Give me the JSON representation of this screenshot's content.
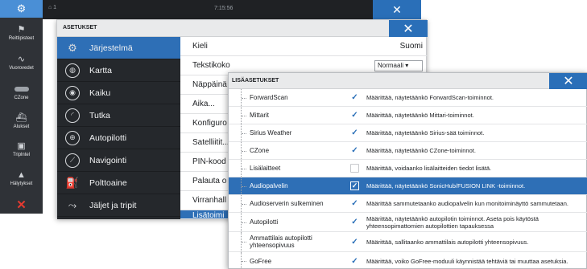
{
  "topbar": {
    "time": "7:15:56",
    "left_indicator": "⌂ 1",
    "close_glyph": "✕"
  },
  "rail": {
    "items": [
      {
        "label": "Reittipisteet",
        "icon": "flag-icon"
      },
      {
        "label": "Vuorovedet",
        "icon": "tide-icon"
      },
      {
        "label": "CZone",
        "icon": "czone-icon"
      },
      {
        "label": "Alukset",
        "icon": "ship-icon"
      },
      {
        "label": "Triplntel",
        "icon": "tripintel-icon"
      },
      {
        "label": "Hälytykset",
        "icon": "alarm-icon"
      }
    ],
    "close_glyph": "✕"
  },
  "settings": {
    "title": "ASETUKSET",
    "close_glyph": "✕",
    "categories": [
      {
        "label": "Järjestelmä",
        "icon": "gear-icon",
        "glyph": "⚙"
      },
      {
        "label": "Kartta",
        "icon": "globe-icon",
        "glyph": "◍"
      },
      {
        "label": "Kaiku",
        "icon": "echo-icon",
        "glyph": "◉"
      },
      {
        "label": "Tutka",
        "icon": "radar-icon",
        "glyph": "◜"
      },
      {
        "label": "Autopilotti",
        "icon": "steering-wheel-icon",
        "glyph": "⊕"
      },
      {
        "label": "Navigointi",
        "icon": "compass-icon",
        "glyph": "⟋"
      },
      {
        "label": "Polttoaine",
        "icon": "fuel-icon",
        "glyph": "⛽"
      },
      {
        "label": "Jäljet ja tripit",
        "icon": "tracks-icon",
        "glyph": "⤳"
      }
    ],
    "options": [
      {
        "label": "Kieli"
      },
      {
        "label": "Tekstikoko"
      },
      {
        "label": "Näppäinä"
      },
      {
        "label": "Aika..."
      },
      {
        "label": "Konfiguro"
      },
      {
        "label": "Satelliitit..."
      },
      {
        "label": "PIN-kood"
      },
      {
        "label": "Palauta o"
      },
      {
        "label": "Virranhall"
      },
      {
        "label": "Lisätoimi"
      }
    ],
    "language_value": "Suomi",
    "text_size_value": "Normaali ▾"
  },
  "advanced": {
    "title": "LISÄASETUKSET",
    "close_glyph": "✕",
    "rows": [
      {
        "name": "ForwardScan",
        "checked": true,
        "desc": "Määrittää, näytetäänkö ForwardScan-toiminnot."
      },
      {
        "name": "Mittarit",
        "checked": true,
        "desc": "Määrittää, näytetäänkö Mittari-toiminnot."
      },
      {
        "name": "Sirius Weather",
        "checked": true,
        "desc": "Määrittää, näytetäänkö Sirius-sää toiminnot."
      },
      {
        "name": "CZone",
        "checked": true,
        "desc": "Määrittää, näytetäänkö CZone-toiminnot."
      },
      {
        "name": "Lisälaitteet",
        "checked": false,
        "desc": "Määrittää, voidaanko lisälaitteiden tiedot lisätä."
      },
      {
        "name": "Audiopalvelin",
        "checked": true,
        "desc": "Määrittää, näytetäänkö SonicHub/FUSION LINK -toiminnot.",
        "selected": true
      },
      {
        "name": "Audioserverin sulkeminen",
        "checked": true,
        "desc": "Määrittää sammutetaanko audiopalvelin kun monitoiminäyttö sammutetaan."
      },
      {
        "name": "Autopilotti",
        "checked": true,
        "desc": "Määrittää, näytetäänkö autopilotin toiminnot. Aseta pois käytöstä yhteensopimattomien autopilottien tapauksessa"
      },
      {
        "name": "Ammattilais autopilotti yhteensopivuus",
        "checked": true,
        "desc": "Määrittää, sallitaanko ammattilais autopilotti yhteensopivuus."
      },
      {
        "name": "GoFree",
        "checked": true,
        "desc": "Määrittää, voiko GoFree-moduuli käynnistää tehtäviä tai muuttaa asetuksia."
      }
    ]
  }
}
